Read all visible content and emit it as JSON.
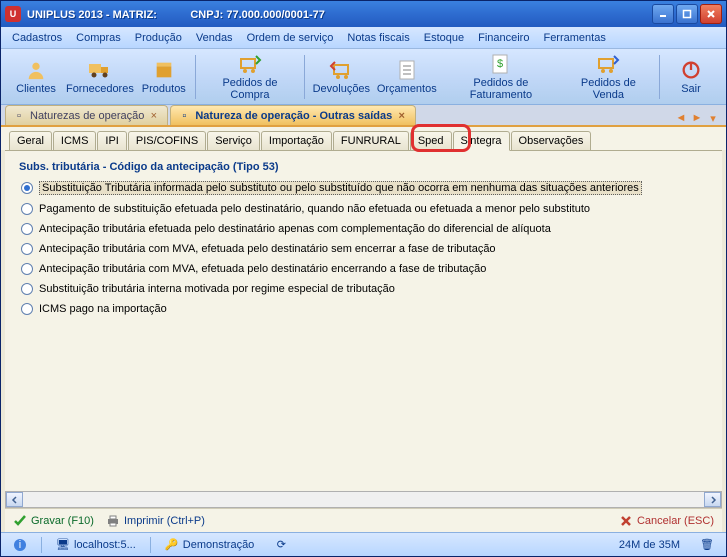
{
  "title": {
    "app": "UNIPLUS  2013 - MATRIZ:",
    "cnpj": "CNPJ: 77.000.000/0001-77"
  },
  "menu": [
    "Cadastros",
    "Compras",
    "Produção",
    "Vendas",
    "Ordem de serviço",
    "Notas fiscais",
    "Estoque",
    "Financeiro",
    "Ferramentas"
  ],
  "toolbar": {
    "clientes": "Clientes",
    "fornecedores": "Fornecedores",
    "produtos": "Produtos",
    "pedidos_compra": "Pedidos de Compra",
    "devolucoes": "Devoluções",
    "orcamentos": "Orçamentos",
    "pedidos_fat": "Pedidos de Faturamento",
    "pedidos_venda": "Pedidos de Venda",
    "sair": "Sair"
  },
  "doctabs": {
    "tab1": "Naturezas de operação",
    "tab2": "Natureza de operação - Outras saídas"
  },
  "innertabs": [
    "Geral",
    "ICMS",
    "IPI",
    "PIS/COFINS",
    "Serviço",
    "Importação",
    "FUNRURAL",
    "Sped",
    "Sintegra",
    "Observações"
  ],
  "group": {
    "title": "Subs. tributária - Código da antecipação (Tipo 53)"
  },
  "radios": [
    "Substituição Tributária informada pelo substituto ou pelo substituído que não ocorra em nenhuma das situações anteriores",
    "Pagamento de substituição efetuada pelo destinatário, quando não efetuada ou efetuada a menor pelo substituto",
    "Antecipação tributária efetuada pelo destinatário apenas com complementação do diferencial de alíquota",
    "Antecipação tributária com MVA, efetuada pelo destinatário sem encerrar a fase de tributação",
    "Antecipação tributária com MVA, efetuada pelo destinatário encerrando a fase de tributação",
    "Substituição tributária interna motivada por regime especial de tributação",
    "ICMS pago na importação"
  ],
  "actions": {
    "gravar": "Gravar (F10)",
    "imprimir": "Imprimir (Ctrl+P)",
    "cancelar": "Cancelar (ESC)"
  },
  "status": {
    "host": "localhost:5...",
    "demo": "Demonstração",
    "mem": "24M de 35M"
  }
}
